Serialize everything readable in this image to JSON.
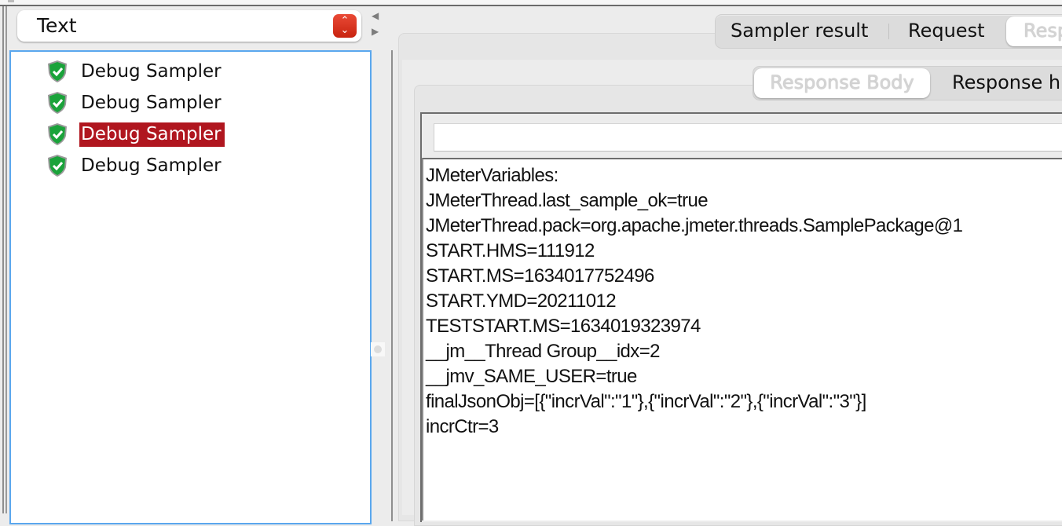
{
  "renderer_select": {
    "value": "Text",
    "icon": "up-down-chevron-icon"
  },
  "splitter": {
    "collapse_left_icon": "triangle-left-icon",
    "expand_right_icon": "triangle-right-icon"
  },
  "results_tree": {
    "items": [
      {
        "label": "Debug Sampler",
        "status_icon": "success-shield-icon",
        "selected": false
      },
      {
        "label": "Debug Sampler",
        "status_icon": "success-shield-icon",
        "selected": false
      },
      {
        "label": "Debug Sampler",
        "status_icon": "success-shield-icon",
        "selected": true
      },
      {
        "label": "Debug Sampler",
        "status_icon": "success-shield-icon",
        "selected": false
      }
    ],
    "selected_color": "#b0161f"
  },
  "main_tabs": [
    {
      "label": "Sampler result",
      "selected": false
    },
    {
      "label": "Request",
      "selected": false
    },
    {
      "label": "Resp",
      "selected": true
    }
  ],
  "response_tabs": [
    {
      "label": "Response Body",
      "selected": true
    },
    {
      "label": "Response h",
      "selected": false
    }
  ],
  "search": {
    "value": ""
  },
  "response_text": [
    "JMeterVariables:",
    "JMeterThread.last_sample_ok=true",
    "JMeterThread.pack=org.apache.jmeter.threads.SamplePackage@1",
    "START.HMS=111912",
    "START.MS=1634017752496",
    "START.YMD=20211012",
    "TESTSTART.MS=1634019323974",
    "__jm__Thread Group__idx=2",
    "__jmv_SAME_USER=true",
    "finalJsonObj=[{\"incrVal\":\"1\"},{\"incrVal\":\"2\"},{\"incrVal\":\"3\"}]",
    "incrCtr=3"
  ]
}
